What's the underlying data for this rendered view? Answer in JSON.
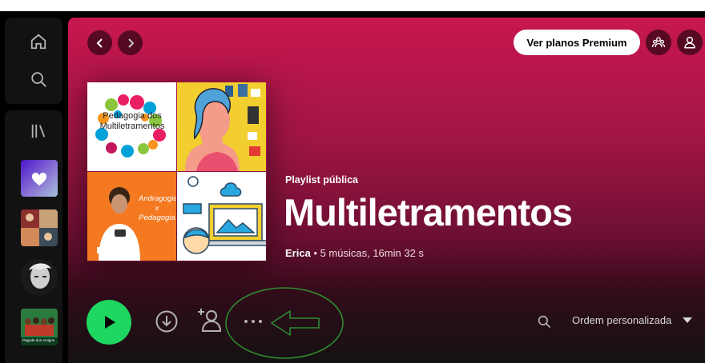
{
  "header": {
    "premium_label": "Ver planos Premium"
  },
  "playlist": {
    "type_label": "Playlist pública",
    "title": "Multiletramentos",
    "owner": "Erica",
    "meta_rest": " • 5 músicas, 16min 32 s"
  },
  "cover_texts": {
    "tile1": "Pedagogia dos Multiletramentos",
    "tile3_line1": "Andragogia",
    "tile3_line2": "x",
    "tile3_line3": "Pedagogia"
  },
  "library": {
    "thumb_caption": "Pagode dos Amigos"
  },
  "toolbar": {
    "sort_label": "Ordem personalizada"
  },
  "colors": {
    "accent_green": "#1ed760",
    "header_gradient_top": "#c8174f",
    "annotation_green": "#2e8b2e"
  },
  "icons": [
    "home-icon",
    "search-icon",
    "library-icon",
    "chevron-left-icon",
    "chevron-right-icon",
    "friends-icon",
    "user-icon",
    "play-icon",
    "download-icon",
    "add-user-icon",
    "more-options-icon",
    "search-icon",
    "caret-down-icon"
  ]
}
